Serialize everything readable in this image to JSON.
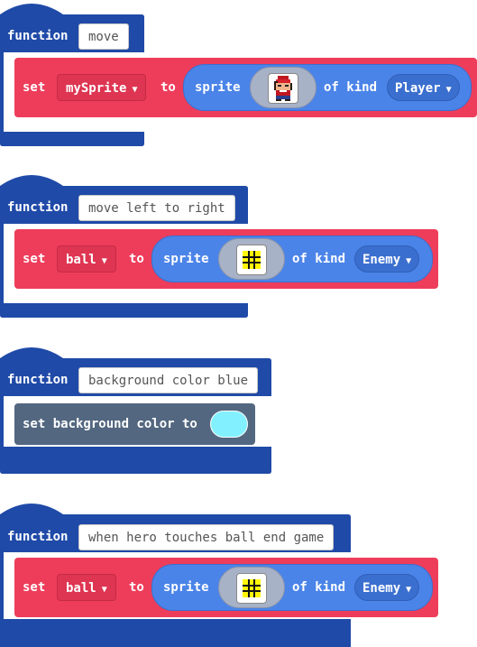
{
  "functions": [
    {
      "keyword": "function",
      "name": "move",
      "set_label": "set",
      "variable": "mySprite",
      "to_label": "to",
      "sprite_label": "sprite",
      "image": "hero-sprite-icon",
      "of_kind_label": "of kind",
      "kind": "Player"
    },
    {
      "keyword": "function",
      "name": "move left to right",
      "set_label": "set",
      "variable": "ball",
      "to_label": "to",
      "sprite_label": "sprite",
      "image": "hash-sprite-icon",
      "of_kind_label": "of kind",
      "kind": "Enemy"
    },
    {
      "keyword": "function",
      "name": "background color blue",
      "statement": "set background color to",
      "color": "#82f0ff"
    },
    {
      "keyword": "function",
      "name": "when hero touches ball end game",
      "set_label": "set",
      "variable": "ball",
      "to_label": "to",
      "sprite_label": "sprite",
      "image": "hash-sprite-icon",
      "of_kind_label": "of kind",
      "kind": "Enemy"
    }
  ],
  "colors": {
    "function_block": "#1f4aa8",
    "set_block": "#ee3d5b",
    "sprite_pill": "#4b84e8",
    "scene_block": "#536780"
  }
}
